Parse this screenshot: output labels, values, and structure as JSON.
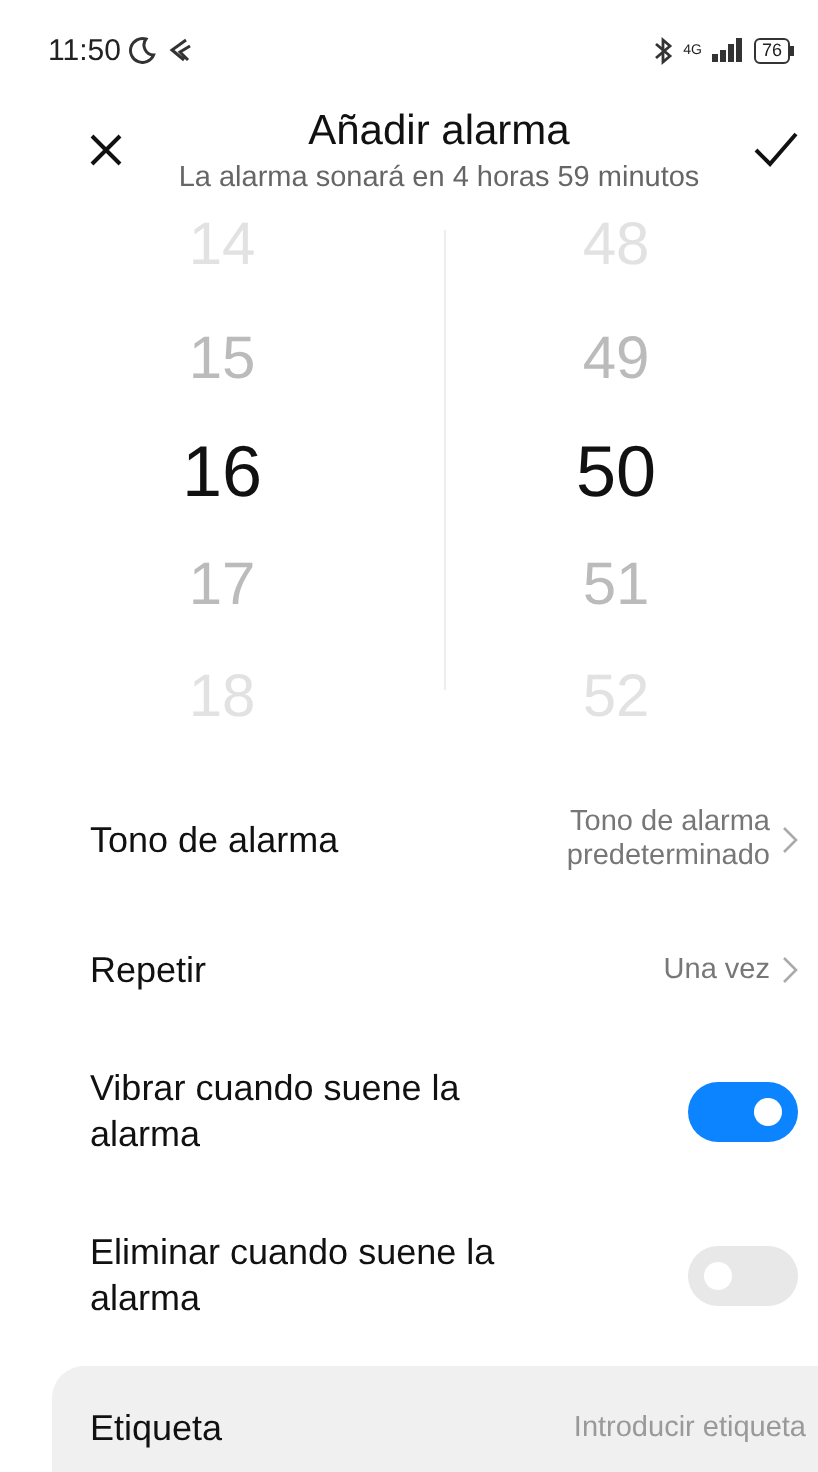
{
  "status_bar": {
    "time": "11:50",
    "network": "4G",
    "battery": "76"
  },
  "header": {
    "title": "Añadir alarma",
    "subtitle": "La alarma sonará en 4 horas 59 minutos"
  },
  "picker": {
    "hours": [
      {
        "value": "14",
        "selected": false
      },
      {
        "value": "15",
        "selected": false
      },
      {
        "value": "16",
        "selected": true
      },
      {
        "value": "17",
        "selected": false
      },
      {
        "value": "18",
        "selected": false
      }
    ],
    "minutes": [
      {
        "value": "48",
        "selected": false
      },
      {
        "value": "49",
        "selected": false
      },
      {
        "value": "50",
        "selected": true
      },
      {
        "value": "51",
        "selected": false
      },
      {
        "value": "52",
        "selected": false
      }
    ]
  },
  "settings": [
    {
      "kind": "link",
      "label": "Tono de alarma",
      "value": "Tono de alarma predeterminado"
    },
    {
      "kind": "link",
      "label": "Repetir",
      "value": "Una vez"
    },
    {
      "kind": "toggle",
      "label": "Vibrar cuando suene la alarma",
      "on": true
    },
    {
      "kind": "toggle",
      "label": "Eliminar cuando suene la alarma",
      "on": false
    },
    {
      "kind": "input",
      "label": "Etiqueta",
      "placeholder": "Introducir etiqueta"
    }
  ]
}
